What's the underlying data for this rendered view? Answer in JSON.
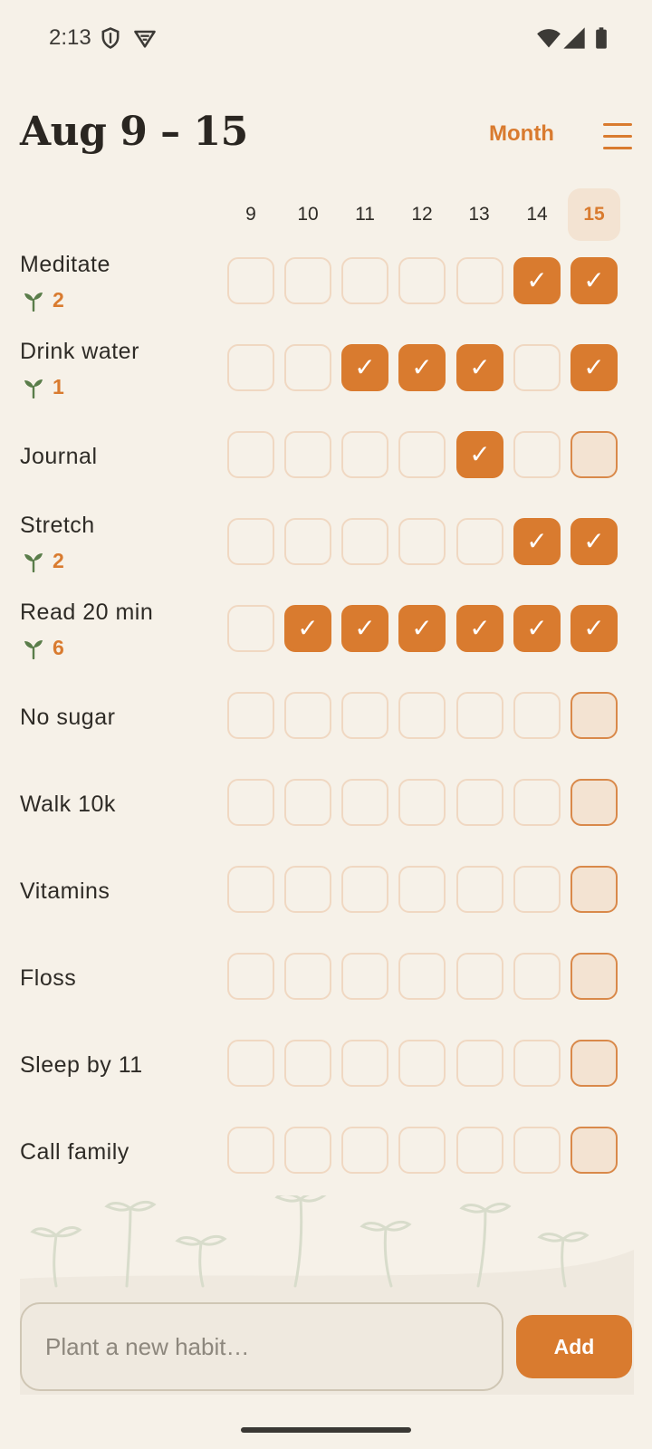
{
  "status_bar": {
    "time": "2:13"
  },
  "header": {
    "title": "Aug 9 – 15",
    "month_label": "Month"
  },
  "days": [
    {
      "label": "9",
      "today": false
    },
    {
      "label": "10",
      "today": false
    },
    {
      "label": "11",
      "today": false
    },
    {
      "label": "12",
      "today": false
    },
    {
      "label": "13",
      "today": false
    },
    {
      "label": "14",
      "today": false
    },
    {
      "label": "15",
      "today": true
    }
  ],
  "habits": [
    {
      "name": "Meditate",
      "streak": "2",
      "checks": [
        false,
        false,
        false,
        false,
        false,
        true,
        true
      ]
    },
    {
      "name": "Drink water",
      "streak": "1",
      "checks": [
        false,
        false,
        true,
        true,
        true,
        false,
        true
      ]
    },
    {
      "name": "Journal",
      "streak": "",
      "checks": [
        false,
        false,
        false,
        false,
        true,
        false,
        false
      ]
    },
    {
      "name": "Stretch",
      "streak": "2",
      "checks": [
        false,
        false,
        false,
        false,
        false,
        true,
        true
      ]
    },
    {
      "name": "Read 20 min",
      "streak": "6",
      "checks": [
        false,
        true,
        true,
        true,
        true,
        true,
        true
      ]
    },
    {
      "name": "No sugar",
      "streak": "",
      "checks": [
        false,
        false,
        false,
        false,
        false,
        false,
        false
      ]
    },
    {
      "name": "Walk 10k",
      "streak": "",
      "checks": [
        false,
        false,
        false,
        false,
        false,
        false,
        false
      ]
    },
    {
      "name": "Vitamins",
      "streak": "",
      "checks": [
        false,
        false,
        false,
        false,
        false,
        false,
        false
      ]
    },
    {
      "name": "Floss",
      "streak": "",
      "checks": [
        false,
        false,
        false,
        false,
        false,
        false,
        false
      ]
    },
    {
      "name": "Sleep by 11",
      "streak": "",
      "checks": [
        false,
        false,
        false,
        false,
        false,
        false,
        false
      ]
    },
    {
      "name": "Call family",
      "streak": "",
      "checks": [
        false,
        false,
        false,
        false,
        false,
        false,
        false
      ]
    }
  ],
  "new_habit": {
    "placeholder": "Plant a new habit…",
    "value": ""
  },
  "add_label": "Add",
  "colors": {
    "accent": "#d97b2f",
    "background": "#f6f1e8",
    "today_fill": "#f3e3d2",
    "sprout": "#5a7d4a"
  }
}
